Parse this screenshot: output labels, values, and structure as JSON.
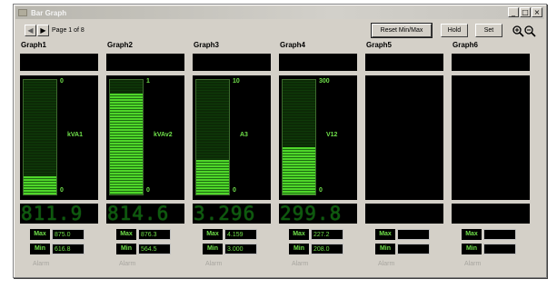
{
  "window": {
    "title": "Bar Graph",
    "controls": [
      "_",
      "□",
      "×"
    ]
  },
  "toolbar": {
    "page_indicator": "Page 1 of 8",
    "prev_icon": "◀",
    "next_icon": "▶",
    "reset_label": "Reset Min/Max",
    "hold_label": "Hold",
    "set_label": "Set"
  },
  "colors": {
    "accent_green": "#6fe04a",
    "bar_green": "#4fd62a",
    "panel_bg": "#000000",
    "window_bg": "#d4d0c8"
  },
  "graphs": [
    {
      "title": "Graph1",
      "scale_max": "0",
      "scale_min": "0",
      "unit": "kVA1",
      "fill": 0.16,
      "digital": "811.9",
      "max_label": "Max",
      "min_label": "Min",
      "max_value": "875.0",
      "min_value": "616.8",
      "alarm": "Alarm"
    },
    {
      "title": "Graph2",
      "scale_max": "1",
      "scale_min": "0",
      "unit": "kVAv2",
      "fill": 0.88,
      "digital": "814.6",
      "max_label": "Max",
      "min_label": "Min",
      "max_value": "876.3",
      "min_value": "564.5",
      "alarm": "Alarm"
    },
    {
      "title": "Graph3",
      "scale_max": "10",
      "scale_min": "0",
      "unit": "A3",
      "fill": 0.3,
      "digital": "3.296",
      "max_label": "Max",
      "min_label": "Min",
      "max_value": "4.159",
      "min_value": "3.000",
      "alarm": "Alarm"
    },
    {
      "title": "Graph4",
      "scale_max": "300",
      "scale_min": "0",
      "unit": "V12",
      "fill": 0.41,
      "digital": "299.8",
      "max_label": "Max",
      "min_label": "Min",
      "max_value": "227.2",
      "min_value": "208.0",
      "alarm": "Alarm"
    },
    {
      "title": "Graph5",
      "max_label": "Max",
      "min_label": "Min",
      "max_value": "",
      "min_value": "",
      "alarm": "Alarm"
    },
    {
      "title": "Graph6",
      "max_label": "Max",
      "min_label": "Min",
      "max_value": "",
      "min_value": "",
      "alarm": "Alarm"
    }
  ]
}
